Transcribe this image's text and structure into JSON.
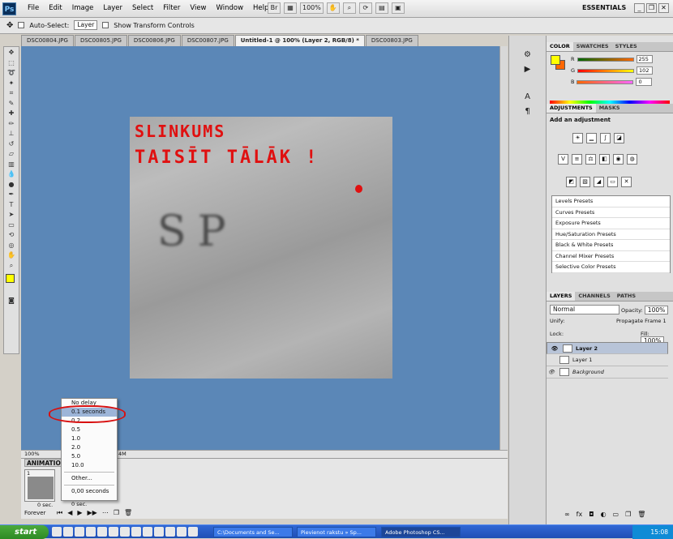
{
  "menubar": {
    "logo": "Ps",
    "items": [
      "File",
      "Edit",
      "Image",
      "Layer",
      "Select",
      "Filter",
      "View",
      "Window",
      "Help"
    ],
    "zoom": "100%",
    "workspace": "ESSENTIALS",
    "br_label": "Br"
  },
  "options": {
    "auto_select_label": "Auto-Select:",
    "auto_select_value": "Layer",
    "transform_label": "Show Transform Controls"
  },
  "tabs": [
    {
      "label": "DSC00804.JPG"
    },
    {
      "label": "DSC00805.JPG"
    },
    {
      "label": "DSC00806.JPG"
    },
    {
      "label": "DSC00807.JPG"
    },
    {
      "label": "Untitled-1 @ 100% (Layer 2, RGB/8) *"
    },
    {
      "label": "DSC00803.JPG"
    }
  ],
  "canvas": {
    "line1": "SLINKUMS",
    "line2": "TAISĪT TĀLĀK !",
    "photo_text": "SP"
  },
  "statusbar": {
    "zoom": "100%",
    "info": "4M"
  },
  "animation": {
    "tab": "ANIMATION",
    "frame_number": "1",
    "frame1_delay": "0 sec.",
    "frame2_delay": "0 sec.",
    "loop": "Forever"
  },
  "delay_menu": {
    "items": [
      "No delay",
      "0.1 seconds",
      "0.2",
      "0.5",
      "1.0",
      "2.0",
      "5.0",
      "10.0"
    ],
    "other": "Other...",
    "current": "0,00 seconds"
  },
  "color_panel": {
    "tabs": [
      "COLOR",
      "SWATCHES",
      "STYLES"
    ],
    "r": "255",
    "g": "102",
    "b": "0",
    "fg_color": "#ffff00",
    "bg_color": "#ff6600"
  },
  "adjustments": {
    "tabs": [
      "ADJUSTMENTS",
      "MASKS"
    ],
    "title": "Add an adjustment",
    "presets": [
      "Levels Presets",
      "Curves Presets",
      "Exposure Presets",
      "Hue/Saturation Presets",
      "Black & White Presets",
      "Channel Mixer Presets",
      "Selective Color Presets"
    ]
  },
  "layers": {
    "tabs": [
      "LAYERS",
      "CHANNELS",
      "PATHS"
    ],
    "blend": "Normal",
    "opacity_label": "Opacity:",
    "opacity": "100%",
    "unify_label": "Unify:",
    "propagate": "Propagate Frame 1",
    "lock_label": "Lock:",
    "fill_label": "Fill:",
    "fill": "100%",
    "items": [
      {
        "name": "Layer 2"
      },
      {
        "name": "Layer 1"
      },
      {
        "name": "Background"
      }
    ]
  },
  "taskbar": {
    "start": "start",
    "tasks": [
      "C:\\Documents and Se...",
      "Pievienot rakstu » Sp...",
      "Adobe Photoshop CS..."
    ],
    "clock": "15:08"
  }
}
